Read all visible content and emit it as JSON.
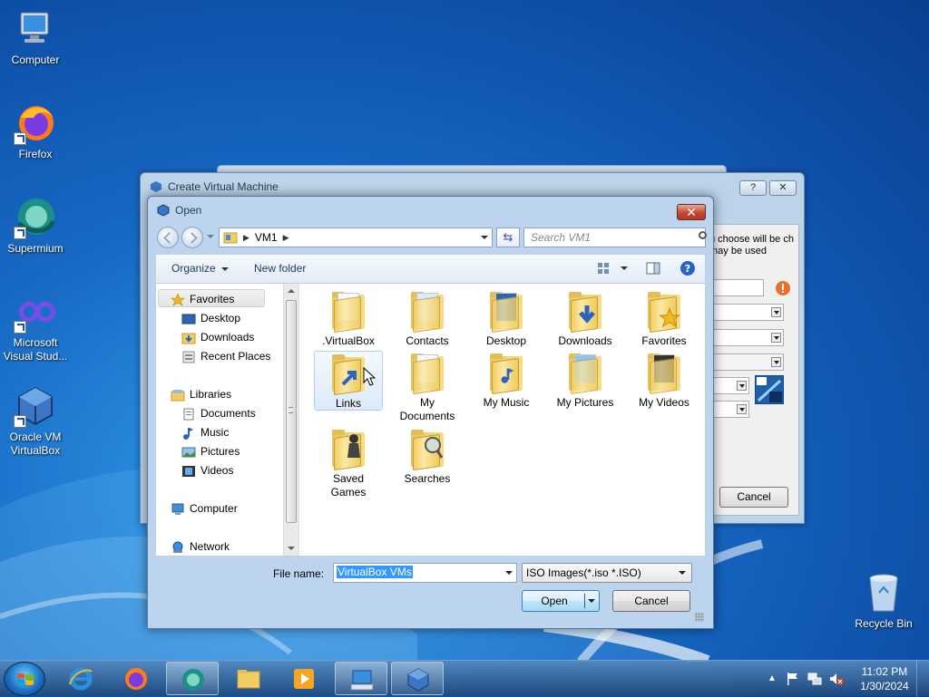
{
  "desktop": {
    "icons": [
      {
        "label": "Computer"
      },
      {
        "label": "Firefox"
      },
      {
        "label": "Supermium"
      },
      {
        "label": "Microsoft Visual Stud..."
      },
      {
        "label": "Oracle VM VirtualBox"
      },
      {
        "label": "Recycle Bin"
      }
    ]
  },
  "back_window": {
    "title": "Create Virtual Machine",
    "help_label": "?",
    "close_label": "✕",
    "text_fragment": "u choose will be ch may be used",
    "cancel_label": "Cancel"
  },
  "open_dialog": {
    "title": "Open",
    "close_label": "✕",
    "address": {
      "crumb": "VM1"
    },
    "search": {
      "placeholder": "Search VM1"
    },
    "toolbar": {
      "organize": "Organize",
      "new_folder": "New folder"
    },
    "nav": {
      "favorites": "Favorites",
      "desktop": "Desktop",
      "downloads": "Downloads",
      "recent_places": "Recent Places",
      "libraries": "Libraries",
      "documents": "Documents",
      "music": "Music",
      "pictures": "Pictures",
      "videos": "Videos",
      "computer": "Computer",
      "network": "Network"
    },
    "files": [
      {
        "name": ".VirtualBox"
      },
      {
        "name": "Contacts"
      },
      {
        "name": "Desktop"
      },
      {
        "name": "Downloads"
      },
      {
        "name": "Favorites"
      },
      {
        "name": "Links"
      },
      {
        "name": "My Documents"
      },
      {
        "name": "My Music"
      },
      {
        "name": "My Pictures"
      },
      {
        "name": "My Videos"
      },
      {
        "name": "Saved Games"
      },
      {
        "name": "Searches"
      }
    ],
    "file_name_label": "File name:",
    "file_name_value": "VirtualBox VMs",
    "file_type": "ISO Images(*.iso *.ISO)",
    "open_label": "Open",
    "cancel_label": "Cancel"
  },
  "taskbar": {
    "clock_time": "11:02 PM",
    "clock_date": "1/30/2024"
  },
  "colors": {
    "accent": "#3399ff",
    "close_red": "#c6462f",
    "folder": "#f2cd63"
  }
}
